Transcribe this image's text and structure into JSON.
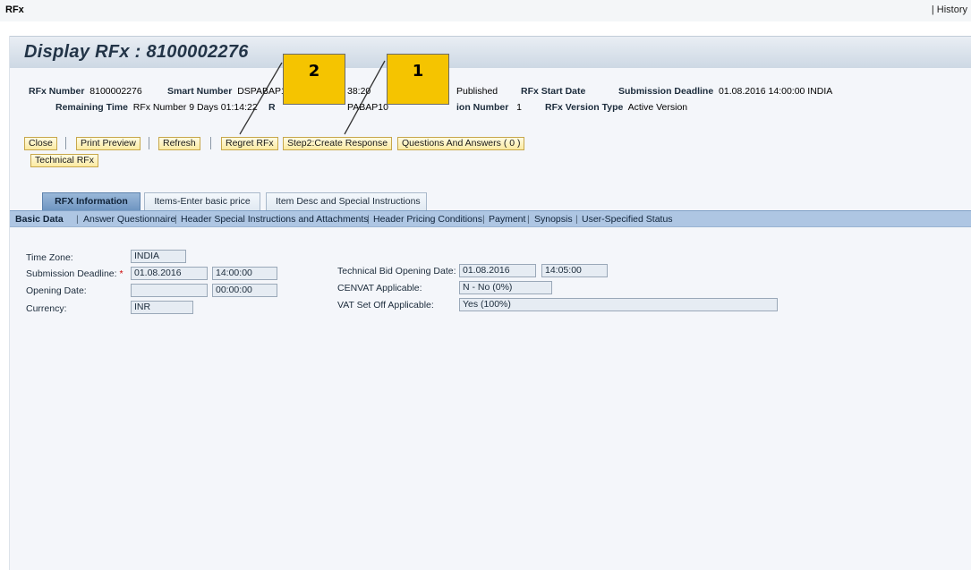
{
  "topbar": {
    "app_name": "RFx",
    "history": "| History"
  },
  "page": {
    "title": "Display RFx : 8100002276"
  },
  "header": {
    "rfx_number_label": "RFx Number",
    "rfx_number_value": "8100002276",
    "smart_number_label": "Smart Number",
    "smart_number_value": "DSPABAP10",
    "time_fragment": "38:20",
    "status_value": "Published",
    "rfx_start_date_label": "RFx Start Date",
    "submission_deadline_label": "Submission Deadline",
    "submission_deadline_value": "01.08.2016 14:00:00 INDIA",
    "remaining_time_label": "Remaining Time",
    "remaining_time_value": "RFx Number 9 Days 01:14:22",
    "row2_fragment_label": "R",
    "row2_fragment_value": "PABAP10",
    "version_number_label": "ion Number",
    "version_number_value": "1",
    "version_type_label": "RFx Version Type",
    "version_type_value": "Active Version"
  },
  "toolbar": {
    "close": "Close",
    "print_preview": "Print Preview",
    "refresh": "Refresh",
    "regret": "Regret RFx",
    "create_response": "Step2:Create Response",
    "qa": "Questions And Answers ( 0 )",
    "technical": "Technical RFx"
  },
  "tabs": [
    "RFX Information",
    "Items-Enter basic price",
    "Item Desc and Special Instructions"
  ],
  "subnav": [
    "Basic Data",
    "Answer Questionnaire",
    "Header Special Instructions and Attachments",
    "Header Pricing Conditions",
    "Payment",
    "Synopsis",
    "User-Specified Status"
  ],
  "form": {
    "time_zone_label": "Time Zone:",
    "time_zone_value": "INDIA",
    "submission_deadline_label": "Submission Deadline:",
    "required_mark": "*",
    "submission_date": "01.08.2016",
    "submission_time": "14:00:00",
    "opening_date_label": "Opening Date:",
    "opening_date_value": "",
    "opening_time": "00:00:00",
    "currency_label": "Currency:",
    "currency_value": "INR",
    "tech_bid_label": "Technical Bid Opening Date:",
    "tech_bid_date": "01.08.2016",
    "tech_bid_time": "14:05:00",
    "cenvat_label": "CENVAT Applicable:",
    "cenvat_value": "N - No (0%)",
    "vat_label": "VAT Set Off Applicable:",
    "vat_value": "Yes (100%)"
  },
  "callouts": {
    "step1": "1",
    "step2": "2"
  },
  "colors": {
    "callout": "#f5c400",
    "button_border": "#c7a74b",
    "subnav": "#aec6e3",
    "title": "#223447"
  }
}
